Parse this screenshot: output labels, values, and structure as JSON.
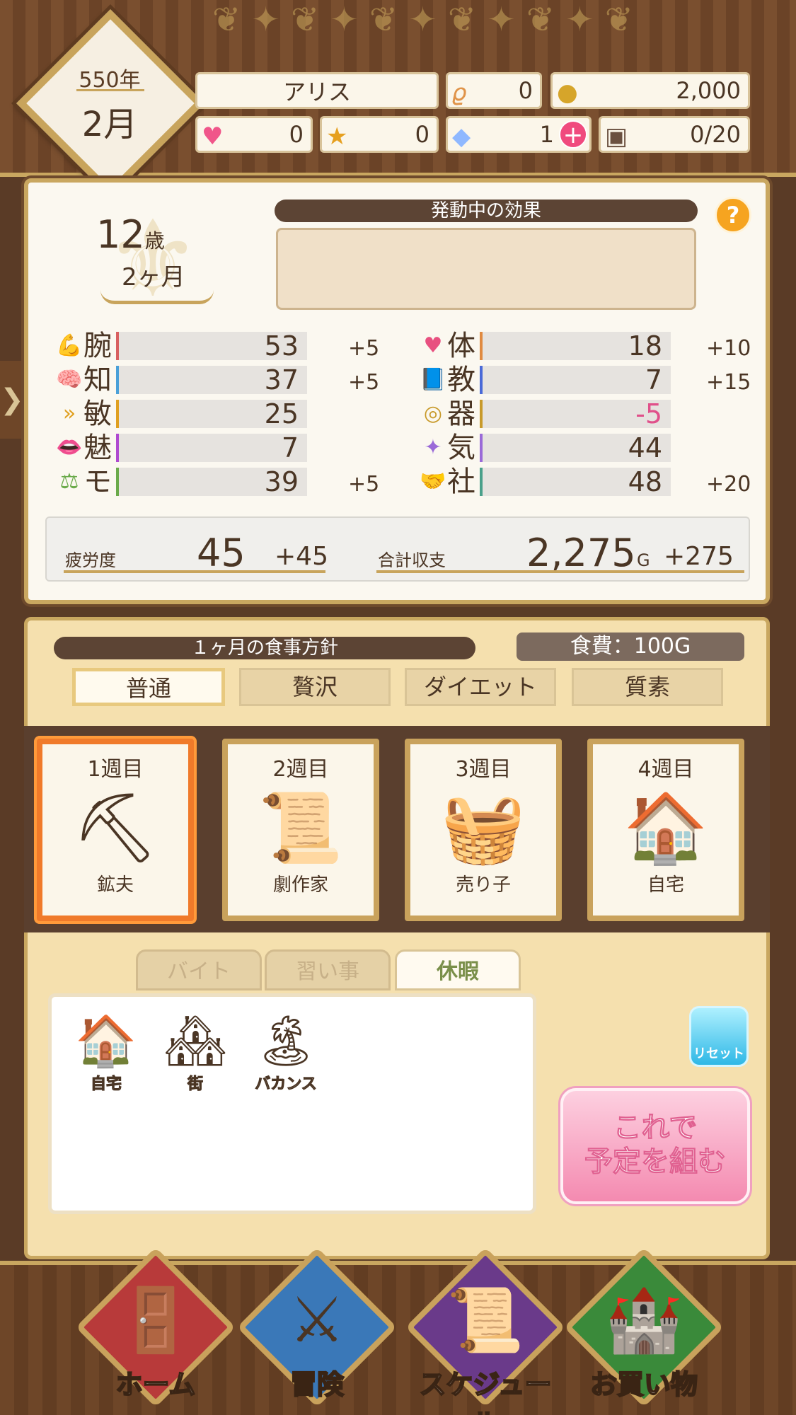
{
  "date": {
    "year": "550年",
    "month": "2月"
  },
  "top_bar": {
    "name": "アリス",
    "resource_1": "0",
    "gold": "2,000",
    "hearts": "0",
    "medals": "0",
    "crystals": "1",
    "inventory": "0/20"
  },
  "profile": {
    "age_years": "12",
    "age_unit": "歳",
    "age_months": "2ヶ月"
  },
  "effects": {
    "title": "発動中の効果",
    "help_label": "?"
  },
  "stats_left": [
    {
      "label": "腕",
      "value": "53",
      "bonus": "+5",
      "icon": "arm-icon"
    },
    {
      "label": "知",
      "value": "37",
      "bonus": "+5",
      "icon": "brain-icon"
    },
    {
      "label": "敏",
      "value": "25",
      "bonus": "",
      "icon": "speed-icon"
    },
    {
      "label": "魅",
      "value": "7",
      "bonus": "",
      "icon": "lips-icon"
    },
    {
      "label": "モ",
      "value": "39",
      "bonus": "+5",
      "icon": "scales-icon"
    }
  ],
  "stats_right": [
    {
      "label": "体",
      "value": "18",
      "bonus": "+10",
      "icon": "heart-icon"
    },
    {
      "label": "教",
      "value": "7",
      "bonus": "+15",
      "icon": "book-icon"
    },
    {
      "label": "器",
      "value": "-5",
      "bonus": "",
      "icon": "target-icon"
    },
    {
      "label": "気",
      "value": "44",
      "bonus": "",
      "icon": "sparkle-icon"
    },
    {
      "label": "社",
      "value": "48",
      "bonus": "+20",
      "icon": "handshake-icon"
    }
  ],
  "summary": {
    "fatigue_label": "疲労度",
    "fatigue_value": "45",
    "fatigue_delta": "+45",
    "income_label": "合計収支",
    "income_value": "2,275",
    "income_unit": "G",
    "income_delta": "+275"
  },
  "meal": {
    "title": "１ヶ月の食事方針",
    "cost": "食費：100G",
    "options": [
      "普通",
      "贅沢",
      "ダイエット",
      "質素"
    ],
    "selected": "普通"
  },
  "weeks": [
    {
      "title": "1週目",
      "job": "鉱夫",
      "icon": "pickaxe-icon"
    },
    {
      "title": "2週目",
      "job": "劇作家",
      "icon": "manuscript-icon"
    },
    {
      "title": "3週目",
      "job": "売り子",
      "icon": "basket-icon"
    },
    {
      "title": "4週目",
      "job": "自宅",
      "icon": "house-icon"
    }
  ],
  "tabs": [
    "バイト",
    "習い事",
    "休暇"
  ],
  "activities": [
    {
      "label": "自宅",
      "icon": "house-icon"
    },
    {
      "label": "街",
      "icon": "town-icon"
    },
    {
      "label": "バカンス",
      "icon": "island-icon"
    }
  ],
  "buttons": {
    "reset": "リセット",
    "confirm_line1": "これで",
    "confirm_line2": "予定を組む"
  },
  "nav": [
    {
      "label": "ホーム",
      "icon": "door-icon"
    },
    {
      "label": "冒険",
      "icon": "swords-icon"
    },
    {
      "label": "スケジュール",
      "icon": "scroll-quill-icon"
    },
    {
      "label": "お買い物",
      "icon": "castle-icon"
    }
  ],
  "colors": {
    "negative_value": "#e0508a",
    "accent_gold": "#c9a760",
    "selected_week": "#f07a2a"
  }
}
